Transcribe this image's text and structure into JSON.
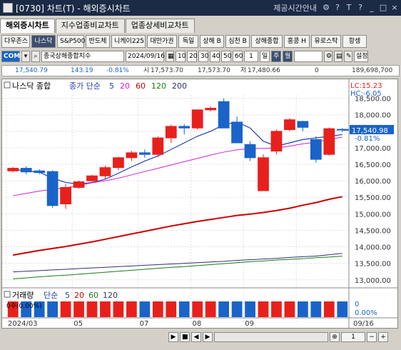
{
  "window": {
    "title": "[0730] 차트(T) - 해외증시차트",
    "notice": "제공시간안내",
    "icons": [
      "gear-icon",
      "help-icon",
      "text-icon",
      "question-icon",
      "minimize-icon",
      "maximize-icon",
      "close-icon"
    ]
  },
  "tabs": [
    "해외증시차트",
    "지수업종비교차트",
    "업종상세비교차트"
  ],
  "buttons": [
    "다우존스",
    "나스닥",
    "S&P500",
    "반도체",
    "니케이225",
    "대만가권",
    "독일",
    "상해 B",
    "심천 B",
    "상해종합",
    "홍콩 H",
    "유로스탁",
    "항셍"
  ],
  "controls": {
    "code": "COMP",
    "name": "종국상해종합지수",
    "date": "2024/09/16",
    "count": "1",
    "periods": [
      "10",
      "20",
      "30",
      "40",
      "50",
      "60"
    ],
    "day": "일",
    "week": "주",
    "month": "월",
    "setting": "설정"
  },
  "info": {
    "price": "17,540.79",
    "change": "143.19",
    "rate": "-0.81%",
    "high_label": "시",
    "high": "17,573.70",
    "open": "17,573.70",
    "low_label": "저",
    "low": "17,480.66",
    "volume": "0",
    "amount": "189,698,700"
  },
  "chart_data": {
    "type": "candlestick",
    "title": "나스닥 종합",
    "ma_label": "종가 단순",
    "ma_periods": [
      "5",
      "20",
      "60",
      "120",
      "200"
    ],
    "ma_colors": [
      "#1f3fb0",
      "#d21fd2",
      "#cc0000",
      "#1a7a1a",
      "#303070"
    ],
    "y_ticks": [
      "18,500.00",
      "18,000.00",
      "17,500.00",
      "17,000.00",
      "16,500.00",
      "16,000.00",
      "15,500.00",
      "15,000.00",
      "14,500.00",
      "14,000.00",
      "13,500.00",
      "13,000.00"
    ],
    "ylim": [
      12800,
      18600
    ],
    "last_price": "17,540.98",
    "lc": "LC:15.23",
    "hc": "HC:-6.05",
    "pct": "-0.81%",
    "candles": [
      {
        "o": 16300,
        "h": 16420,
        "l": 16260,
        "c": 16380
      },
      {
        "o": 16380,
        "h": 16440,
        "l": 16200,
        "c": 16270
      },
      {
        "o": 16300,
        "h": 16350,
        "l": 16200,
        "c": 16250
      },
      {
        "o": 16280,
        "h": 16320,
        "l": 15180,
        "c": 15250
      },
      {
        "o": 15300,
        "h": 15900,
        "l": 15150,
        "c": 15800
      },
      {
        "o": 15800,
        "h": 16010,
        "l": 15760,
        "c": 15970
      },
      {
        "o": 16000,
        "h": 16180,
        "l": 15950,
        "c": 16150
      },
      {
        "o": 16150,
        "h": 16460,
        "l": 16050,
        "c": 16400
      },
      {
        "o": 16400,
        "h": 16720,
        "l": 16320,
        "c": 16700
      },
      {
        "o": 16700,
        "h": 16910,
        "l": 16600,
        "c": 16850
      },
      {
        "o": 16850,
        "h": 16950,
        "l": 16700,
        "c": 16800
      },
      {
        "o": 16800,
        "h": 17350,
        "l": 16720,
        "c": 17300
      },
      {
        "o": 17300,
        "h": 17700,
        "l": 17150,
        "c": 17650
      },
      {
        "o": 17650,
        "h": 17720,
        "l": 17400,
        "c": 17600
      },
      {
        "o": 17600,
        "h": 18150,
        "l": 17550,
        "c": 18150
      },
      {
        "o": 18150,
        "h": 18250,
        "l": 18100,
        "c": 18200
      },
      {
        "o": 18400,
        "h": 18500,
        "l": 17600,
        "c": 17600
      },
      {
        "o": 17780,
        "h": 17950,
        "l": 17150,
        "c": 17150
      },
      {
        "o": 17100,
        "h": 17200,
        "l": 16600,
        "c": 16700
      },
      {
        "o": 15700,
        "h": 16800,
        "l": 15700,
        "c": 16700
      },
      {
        "o": 16900,
        "h": 17550,
        "l": 16800,
        "c": 17500
      },
      {
        "o": 17550,
        "h": 17900,
        "l": 17500,
        "c": 17850
      },
      {
        "o": 17800,
        "h": 17820,
        "l": 17500,
        "c": 17620
      },
      {
        "o": 17250,
        "h": 17350,
        "l": 16550,
        "c": 16650
      },
      {
        "o": 16800,
        "h": 17620,
        "l": 16760,
        "c": 17580
      },
      {
        "o": 17560,
        "h": 17600,
        "l": 17480,
        "c": 17540
      }
    ],
    "ma5": [
      16350,
      16300,
      16260,
      16080,
      15950,
      15900,
      15950,
      16050,
      16230,
      16420,
      16600,
      16750,
      16950,
      17150,
      17350,
      17500,
      17700,
      17780,
      17600,
      17200,
      17050,
      17150,
      17250,
      17300,
      17350,
      17400
    ],
    "ma20": [
      15550,
      15620,
      15690,
      15740,
      15790,
      15860,
      15940,
      16000,
      16080,
      16180,
      16280,
      16380,
      16480,
      16580,
      16680,
      16780,
      16870,
      16940,
      16980,
      16980,
      17000,
      17050,
      17120,
      17170,
      17260,
      17320
    ],
    "ma60": [
      13750,
      13820,
      13890,
      13950,
      14010,
      14080,
      14150,
      14230,
      14310,
      14390,
      14470,
      14550,
      14630,
      14700,
      14770,
      14830,
      14890,
      14950,
      14990,
      15040,
      15100,
      15170,
      15260,
      15340,
      15440,
      15520
    ],
    "ma120": [
      13030,
      13060,
      13090,
      13120,
      13140,
      13170,
      13200,
      13230,
      13260,
      13290,
      13320,
      13350,
      13380,
      13400,
      13430,
      13460,
      13490,
      13520,
      13550,
      13570,
      13600,
      13620,
      13640,
      13670,
      13690,
      13720
    ],
    "ma200": [
      13240,
      13260,
      13280,
      13300,
      13320,
      13340,
      13360,
      13380,
      13400,
      13420,
      13440,
      13460,
      13480,
      13500,
      13520,
      13540,
      13560,
      13590,
      13610,
      13630,
      13650,
      13680,
      13700,
      13720,
      13760,
      13800
    ],
    "volume": {
      "label": "거래량",
      "ma_label": "단순",
      "ma_periods": [
        "5",
        "20",
        "60",
        "120"
      ],
      "right_top": "0",
      "right_bottom": "0.00%",
      "inline": "0주(0.00%)",
      "bars": [
        1,
        1,
        1,
        1,
        1,
        1,
        1,
        1,
        1,
        1,
        1,
        1,
        1,
        1,
        1,
        1,
        1,
        1,
        1,
        1,
        1,
        1,
        1,
        1,
        1,
        1
      ]
    },
    "x_labels": [
      "2024/03",
      "05",
      "07",
      "08",
      "09",
      "09/16"
    ]
  },
  "scroll": {
    "page": "1",
    "icons": [
      "play-icon",
      "stop-icon",
      "prev-icon",
      "next-icon",
      "zoom-icon"
    ]
  }
}
